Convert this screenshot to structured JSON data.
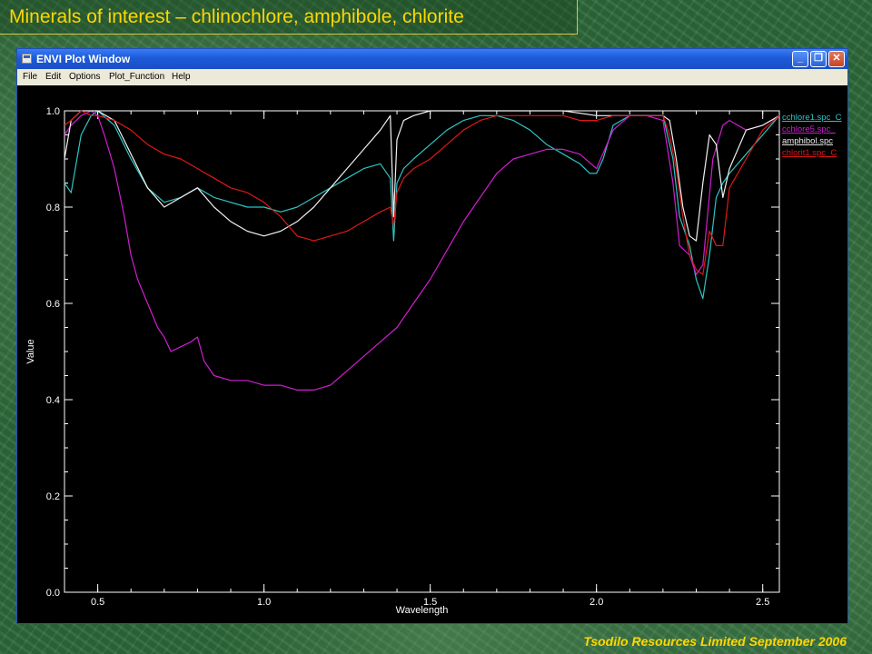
{
  "slide": {
    "title": "Minerals of interest – chlinochlore, amphibole, chlorite",
    "footer": "Tsodilo Resources Limited September 2006"
  },
  "window": {
    "title": "ENVI Plot Window",
    "controls": {
      "minimize": "_",
      "maximize": "❐",
      "close": "✕"
    }
  },
  "menu": [
    "File",
    "Edit",
    "Options",
    "Plot_Function",
    "Help"
  ],
  "chart_data": {
    "type": "line",
    "xlabel": "Wavelength",
    "ylabel": "Value",
    "xlim": [
      0.4,
      2.55
    ],
    "ylim": [
      0.0,
      1.0
    ],
    "xticks": [
      "0.5",
      "1.0",
      "1.5",
      "2.0",
      "2.5"
    ],
    "yticks": [
      "0.0",
      "0.2",
      "0.4",
      "0.6",
      "0.8",
      "1.0"
    ],
    "legend_placement": "right",
    "series": [
      {
        "name": "cchlore1.spc_C",
        "color": "#2ec4c4",
        "x": [
          0.4,
          0.42,
          0.45,
          0.48,
          0.5,
          0.55,
          0.6,
          0.65,
          0.7,
          0.75,
          0.8,
          0.85,
          0.9,
          0.95,
          1.0,
          1.05,
          1.1,
          1.15,
          1.2,
          1.25,
          1.3,
          1.35,
          1.38,
          1.39,
          1.4,
          1.42,
          1.45,
          1.5,
          1.55,
          1.6,
          1.65,
          1.7,
          1.75,
          1.8,
          1.85,
          1.9,
          1.95,
          1.98,
          2.0,
          2.02,
          2.05,
          2.1,
          2.15,
          2.2,
          2.23,
          2.25,
          2.28,
          2.3,
          2.32,
          2.34,
          2.36,
          2.38,
          2.4,
          2.45,
          2.5,
          2.55
        ],
        "y": [
          0.85,
          0.83,
          0.95,
          0.99,
          1.0,
          0.97,
          0.9,
          0.84,
          0.81,
          0.82,
          0.84,
          0.82,
          0.81,
          0.8,
          0.8,
          0.79,
          0.8,
          0.82,
          0.84,
          0.86,
          0.88,
          0.89,
          0.86,
          0.73,
          0.85,
          0.88,
          0.9,
          0.93,
          0.96,
          0.98,
          0.99,
          0.99,
          0.98,
          0.96,
          0.93,
          0.91,
          0.89,
          0.87,
          0.87,
          0.9,
          0.97,
          0.99,
          0.99,
          0.99,
          0.9,
          0.78,
          0.72,
          0.65,
          0.61,
          0.7,
          0.82,
          0.85,
          0.87,
          0.91,
          0.95,
          0.99
        ]
      },
      {
        "name": "cchlore5.spc_",
        "color": "#d01ed0",
        "x": [
          0.4,
          0.42,
          0.45,
          0.48,
          0.5,
          0.52,
          0.55,
          0.58,
          0.6,
          0.62,
          0.65,
          0.68,
          0.7,
          0.72,
          0.75,
          0.78,
          0.8,
          0.82,
          0.85,
          0.9,
          0.95,
          1.0,
          1.05,
          1.1,
          1.15,
          1.2,
          1.25,
          1.3,
          1.35,
          1.4,
          1.45,
          1.5,
          1.55,
          1.6,
          1.65,
          1.7,
          1.75,
          1.8,
          1.85,
          1.9,
          1.95,
          2.0,
          2.05,
          2.1,
          2.15,
          2.2,
          2.23,
          2.25,
          2.28,
          2.3,
          2.32,
          2.35,
          2.38,
          2.4,
          2.45,
          2.5,
          2.55
        ],
        "y": [
          0.95,
          0.97,
          0.99,
          1.0,
          0.99,
          0.95,
          0.88,
          0.78,
          0.7,
          0.65,
          0.6,
          0.55,
          0.53,
          0.5,
          0.51,
          0.52,
          0.53,
          0.48,
          0.45,
          0.44,
          0.44,
          0.43,
          0.43,
          0.42,
          0.42,
          0.43,
          0.46,
          0.49,
          0.52,
          0.55,
          0.6,
          0.65,
          0.71,
          0.77,
          0.82,
          0.87,
          0.9,
          0.91,
          0.92,
          0.92,
          0.91,
          0.88,
          0.96,
          0.99,
          0.99,
          0.98,
          0.85,
          0.72,
          0.7,
          0.66,
          0.68,
          0.9,
          0.97,
          0.98,
          0.96,
          0.97,
          0.99
        ]
      },
      {
        "name": "amphibol.spc",
        "color": "#f0f0f0",
        "x": [
          0.4,
          0.42,
          0.45,
          0.48,
          0.5,
          0.55,
          0.6,
          0.65,
          0.7,
          0.75,
          0.8,
          0.85,
          0.9,
          0.95,
          1.0,
          1.05,
          1.1,
          1.15,
          1.2,
          1.25,
          1.3,
          1.35,
          1.38,
          1.39,
          1.4,
          1.42,
          1.45,
          1.5,
          1.6,
          1.7,
          1.8,
          1.9,
          2.0,
          2.1,
          2.15,
          2.2,
          2.22,
          2.24,
          2.26,
          2.28,
          2.3,
          2.32,
          2.34,
          2.36,
          2.38,
          2.4,
          2.45,
          2.5,
          2.55
        ],
        "y": [
          0.9,
          0.98,
          1.0,
          1.0,
          1.0,
          0.98,
          0.91,
          0.84,
          0.8,
          0.82,
          0.84,
          0.8,
          0.77,
          0.75,
          0.74,
          0.75,
          0.77,
          0.8,
          0.84,
          0.88,
          0.92,
          0.96,
          0.99,
          0.78,
          0.94,
          0.98,
          0.99,
          1.0,
          1.0,
          1.0,
          1.0,
          1.0,
          0.99,
          0.99,
          0.99,
          0.99,
          0.98,
          0.9,
          0.8,
          0.74,
          0.73,
          0.85,
          0.95,
          0.93,
          0.82,
          0.88,
          0.96,
          0.97,
          0.99
        ]
      },
      {
        "name": "chlorit1.spc_C",
        "color": "#e01818",
        "x": [
          0.4,
          0.42,
          0.45,
          0.48,
          0.5,
          0.55,
          0.6,
          0.65,
          0.7,
          0.75,
          0.8,
          0.85,
          0.9,
          0.95,
          1.0,
          1.05,
          1.1,
          1.15,
          1.2,
          1.25,
          1.3,
          1.35,
          1.38,
          1.39,
          1.4,
          1.42,
          1.45,
          1.5,
          1.55,
          1.6,
          1.65,
          1.7,
          1.75,
          1.8,
          1.85,
          1.9,
          1.95,
          2.0,
          2.05,
          2.1,
          2.15,
          2.2,
          2.22,
          2.24,
          2.26,
          2.28,
          2.3,
          2.32,
          2.34,
          2.36,
          2.38,
          2.4,
          2.45,
          2.5,
          2.55
        ],
        "y": [
          0.97,
          0.98,
          1.0,
          0.99,
          0.99,
          0.98,
          0.96,
          0.93,
          0.91,
          0.9,
          0.88,
          0.86,
          0.84,
          0.83,
          0.81,
          0.78,
          0.74,
          0.73,
          0.74,
          0.75,
          0.77,
          0.79,
          0.8,
          0.76,
          0.83,
          0.86,
          0.88,
          0.9,
          0.93,
          0.96,
          0.98,
          0.99,
          0.99,
          0.99,
          0.99,
          0.99,
          0.98,
          0.98,
          0.99,
          0.99,
          0.99,
          0.99,
          0.95,
          0.88,
          0.78,
          0.7,
          0.67,
          0.66,
          0.75,
          0.72,
          0.72,
          0.84,
          0.9,
          0.96,
          0.99
        ]
      }
    ]
  }
}
